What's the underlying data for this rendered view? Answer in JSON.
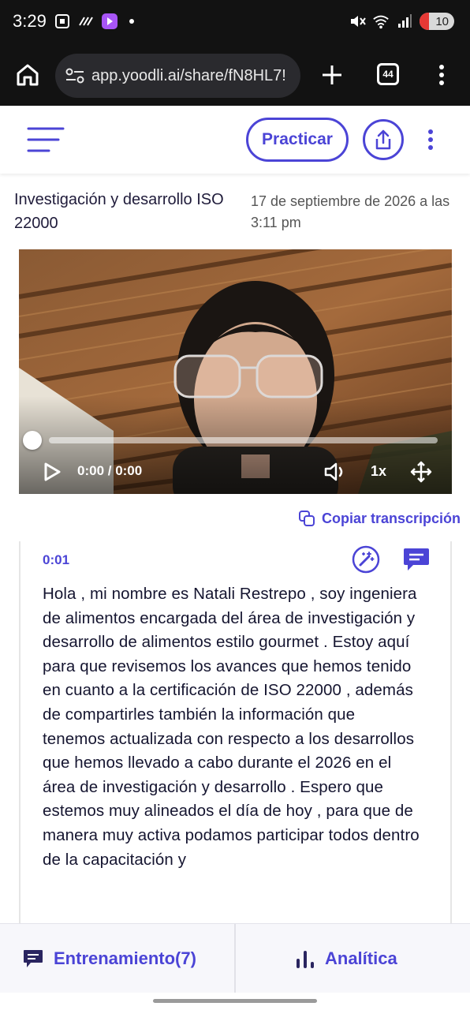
{
  "status_bar": {
    "time": "3:29",
    "battery_level": "10",
    "colors": {
      "background": "#121212",
      "battery_low": "#e53935"
    }
  },
  "browser": {
    "url": "app.yoodli.ai/share/fN8HL7!",
    "tab_count": "44"
  },
  "header": {
    "practicar_label": "Practicar",
    "accent_color": "#4b44d6"
  },
  "session": {
    "title": "Investigación y desarrollo ISO 22000",
    "date": "17 de septiembre de 2026 a las 3:11 pm"
  },
  "video": {
    "time_display": "0:00 / 0:00",
    "speed": "1x",
    "progress": 0.0
  },
  "transcript": {
    "copy_label": "Copiar transcripción",
    "timestamp": "0:01",
    "text": "Hola , mi nombre es Natali  Restrepo , soy ingeniera de alimentos encargada del área de investigación y desarrollo de alimentos estilo gourmet . Estoy aquí para que revisemos los avances que hemos tenido en cuanto a la certificación de ISO 22000 , además de compartirles también la información que tenemos actualizada con respecto a los desarrollos que hemos llevado a cabo durante el 2026 en el área de investigación y desarrollo . Espero que estemos muy alineados el día de hoy , para que de manera muy activa podamos participar todos dentro de la capacitación y"
  },
  "bottom_nav": {
    "training_label": "Entrenamiento(7)",
    "analytics_label": "Analítica"
  }
}
